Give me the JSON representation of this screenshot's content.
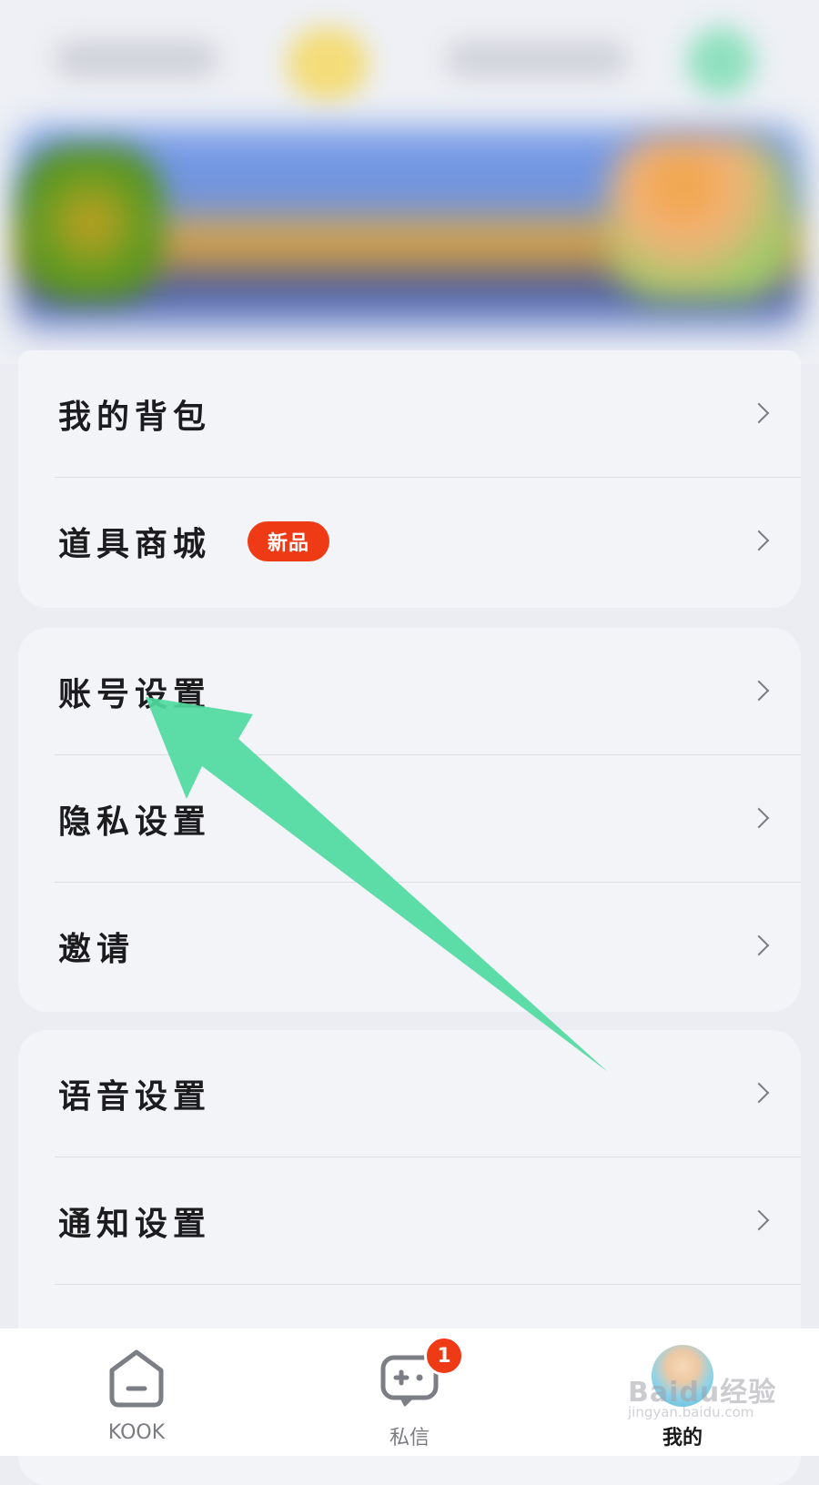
{
  "menu_groups": [
    {
      "items": [
        {
          "label": "我的背包"
        },
        {
          "label": "道具商城",
          "badge": "新品"
        }
      ]
    },
    {
      "items": [
        {
          "label": "账号设置"
        },
        {
          "label": "隐私设置"
        },
        {
          "label": "邀请"
        }
      ]
    },
    {
      "items": [
        {
          "label": "语音设置"
        },
        {
          "label": "通知设置"
        }
      ]
    }
  ],
  "bottom_nav": {
    "items": [
      {
        "label": "KOOK",
        "icon": "home-icon"
      },
      {
        "label": "私信",
        "icon": "gamepad-icon",
        "badge": "1"
      },
      {
        "label": "我的",
        "icon": "avatar",
        "active": true
      }
    ]
  },
  "watermark": {
    "text": "Baidu经验",
    "sub": "jingyan.baidu.com"
  },
  "colors": {
    "badge": "#ee3b16",
    "arrow": "#4fd9a0",
    "card": "#f3f4f8",
    "background": "#ebedf3"
  }
}
